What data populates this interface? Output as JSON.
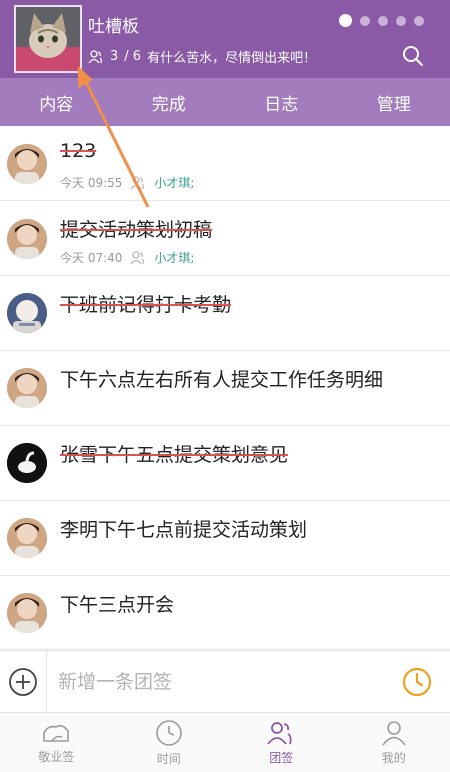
{
  "header": {
    "title": "吐槽板",
    "member_count": "3",
    "member_total": "/ 6",
    "subtitle": "有什么苦水，尽情倒出来吧！",
    "pager_dots": 5,
    "active_dot": 0,
    "accent_color": "#8a5aa6"
  },
  "tabs": [
    {
      "label": "内容"
    },
    {
      "label": "完成"
    },
    {
      "label": "日志"
    },
    {
      "label": "管理"
    }
  ],
  "items": [
    {
      "text": "123",
      "done": true,
      "time": "今天 09:55",
      "assignee": "小才琪;"
    },
    {
      "text": "提交活动策划初稿",
      "done": true,
      "time": "今天 07:40",
      "assignee": "小才琪;"
    },
    {
      "text": "下班前记得打卡考勤",
      "done": true
    },
    {
      "text": "下午六点左右所有人提交工作任务明细",
      "done": false
    },
    {
      "text": "张雪下午五点提交策划意见",
      "done": true
    },
    {
      "text": "李明下午七点前提交活动策划",
      "done": false
    },
    {
      "text": "下午三点开会",
      "done": false
    }
  ],
  "input": {
    "placeholder": "新增一条团签"
  },
  "bottom_nav": [
    {
      "label": "敬业签",
      "icon": "cloud-icon"
    },
    {
      "label": "时间",
      "icon": "clock-icon"
    },
    {
      "label": "团签",
      "icon": "group-icon",
      "active": true
    },
    {
      "label": "我的",
      "icon": "user-icon"
    }
  ],
  "colors": {
    "header": "#8a5aa6",
    "tabs": "#a27cbc",
    "assignee": "#3aa18f",
    "strike": "#d9534f",
    "clock": "#f0a020",
    "arrow": "#f0904a"
  }
}
